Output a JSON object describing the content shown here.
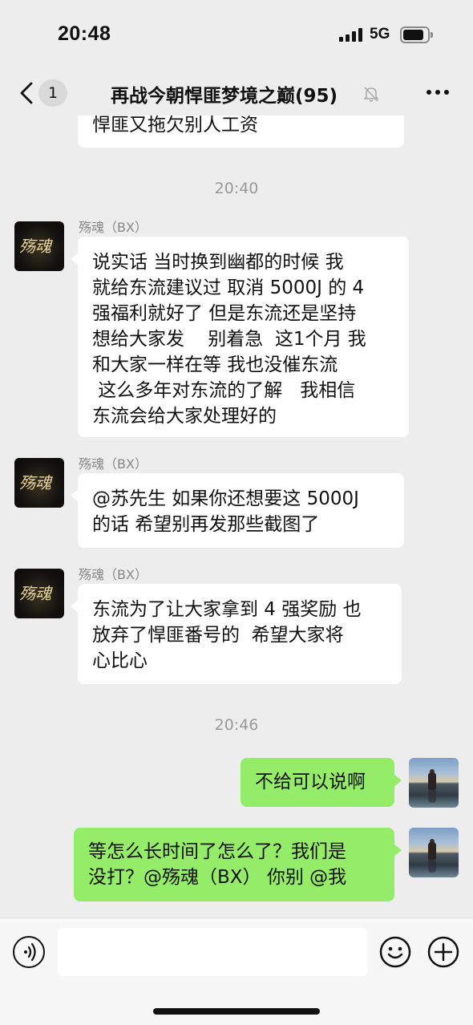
{
  "status_bar": {
    "time": "20:48",
    "network": "5G"
  },
  "nav": {
    "unread_count": "1",
    "title": "再战今朝悍匪梦境之巅(95)"
  },
  "messages": [
    {
      "type": "incoming",
      "partial": true,
      "text": "悍匪又拖欠别人工资"
    },
    {
      "type": "timestamp",
      "text": "20:40"
    },
    {
      "type": "incoming",
      "sender": "殇魂（BX）",
      "lines": [
        "说实话 当时换到幽都的时候 我",
        "就给东流建议过 取消 5000J 的 4",
        "强福利就好了 但是东流还是坚持",
        "想给大家发    别着急  这1个月 我",
        "和大家一样在等  我也没催东流",
        " 这么多年对东流的了解   我相信",
        "东流会给大家处理好的"
      ]
    },
    {
      "type": "incoming",
      "sender": "殇魂（BX）",
      "lines": [
        "@苏先生 如果你还想要这 5000J",
        "的话 希望别再发那些截图了"
      ]
    },
    {
      "type": "incoming",
      "sender": "殇魂（BX）",
      "lines": [
        "东流为了让大家拿到 4 强奖励 也",
        "放弃了悍匪番号的  希望大家将",
        "心比心"
      ]
    },
    {
      "type": "timestamp",
      "text": "20:46"
    },
    {
      "type": "outgoing",
      "lines": [
        "不给可以说啊"
      ]
    },
    {
      "type": "outgoing",
      "lines": [
        "等怎么长时间了怎么了？我们是",
        "没打？@殇魂（BX） 你别 @我"
      ]
    }
  ],
  "input_bar": {
    "placeholder": ""
  },
  "colors": {
    "background": "#ededed",
    "outgoing_bubble": "#95ec69",
    "incoming_bubble": "#ffffff",
    "timestamp_text": "#9a9a9a"
  },
  "icons": {
    "back": "chevron-left-icon",
    "mute": "bell-slash-icon",
    "more": "ellipsis-icon",
    "voice": "voice-wave-icon",
    "emoji": "smile-icon",
    "plus": "plus-circle-icon"
  }
}
